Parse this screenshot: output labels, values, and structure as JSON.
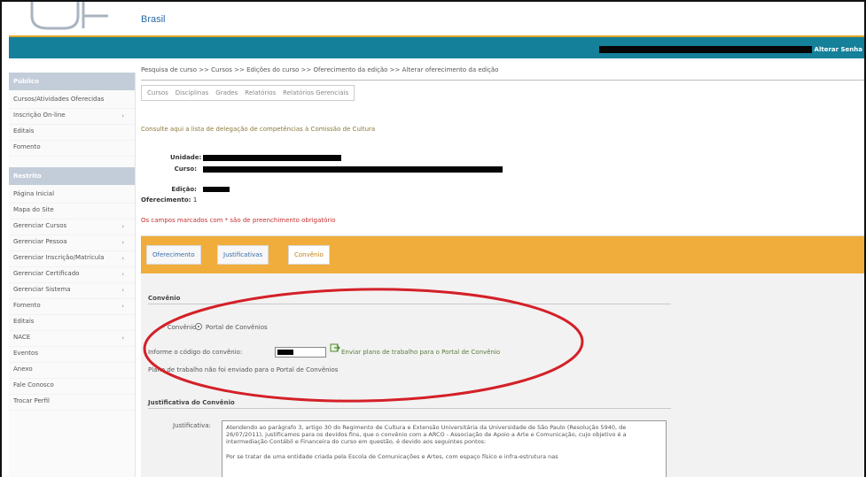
{
  "header": {
    "brand": "Brasil",
    "alterar_label": "Alterar Senha"
  },
  "sidebar": {
    "group1_title": "Público",
    "group1_items": [
      {
        "label": "Cursos/Atividades Oferecidas",
        "chevron": false
      },
      {
        "label": "Inscrição On-line",
        "chevron": true
      },
      {
        "label": "Editais",
        "chevron": false
      },
      {
        "label": "Fomento",
        "chevron": false
      }
    ],
    "group2_title": "Restrito",
    "group2_items": [
      {
        "label": "Página Inicial",
        "chevron": false
      },
      {
        "label": "Mapa do Site",
        "chevron": false
      },
      {
        "label": "Gerenciar Cursos",
        "chevron": true
      },
      {
        "label": "Gerenciar Pessoa",
        "chevron": true
      },
      {
        "label": "Gerenciar Inscrição/Matrícula",
        "chevron": true
      },
      {
        "label": "Gerenciar Certificado",
        "chevron": true
      },
      {
        "label": "Gerenciar Sistema",
        "chevron": true
      },
      {
        "label": "Fomento",
        "chevron": true
      },
      {
        "label": "Editais",
        "chevron": false
      },
      {
        "label": "NACE",
        "chevron": true
      },
      {
        "label": "Eventos",
        "chevron": false
      },
      {
        "label": "Anexo",
        "chevron": false
      },
      {
        "label": "Fale Conosco",
        "chevron": false
      },
      {
        "label": "Trocar Perfil",
        "chevron": false
      }
    ]
  },
  "main": {
    "breadcrumb": "Pesquisa de curso >> Cursos >> Edições do curso >> Oferecimento da edição >> Alterar oferecimento da edição",
    "subnav": [
      "Cursos",
      "Disciplinas",
      "Grades",
      "Relatórios",
      "Relatórios Gerenciais"
    ],
    "intro": "Consulte aqui a lista de delegação de competências à Comissão de Cultura",
    "fields": {
      "unidade_label": "Unidade:",
      "curso_label": "Curso:",
      "edicao_label": "Edição:",
      "oferecimento_label": "Oferecimento:",
      "oferecimento_value": "1"
    },
    "required_note": "Os campos marcados com * são de preenchimento obrigatório",
    "tabs": [
      "Oferecimento",
      "Justificativas",
      "Convênio"
    ],
    "convenio": {
      "section_title": "Convênio",
      "radio_prefix": "* Convênio:",
      "radio_label": "Portal de Convênios",
      "code_label": "Informe o código do convênio:",
      "send_link": "Enviar plano de trabalho para o Portal de Convênio",
      "status_text": "Plano de trabalho não foi enviado para o Portal de Convênios"
    },
    "justificativa": {
      "section_title": "Justificativa do Convênio",
      "field_label": "Justificativa:",
      "text1": "Atendendo ao parágrafo 3, artigo 30 do Regimento de Cultura e Extensão Universitária da Universidade de São Paulo (Resolução 5940, de 26/07/2011), justificamos para os devidos fins, que o convênio com a ARCO - Associação de Apoio a Arte e Comunicação, cujo objetivo é a intermediação Contábil e Financeira do curso em questão, é devido aos seguintes pontos:",
      "text2": "Por se tratar de uma entidade criada pela Escola de Comunicações e Artes, com espaço físico e infra-estrutura nas"
    }
  }
}
